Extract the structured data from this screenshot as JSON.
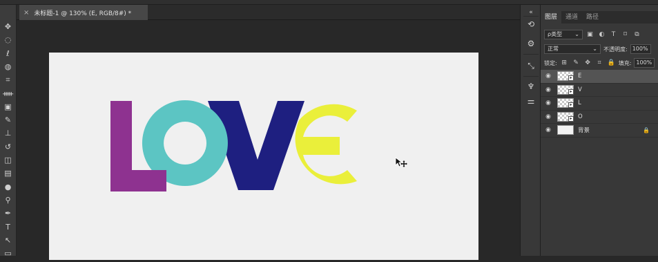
{
  "document": {
    "tab_title": "未标题-1 @ 130% (E, RGB/8#) *",
    "close_glyph": "×"
  },
  "artwork": {
    "letters": [
      "L",
      "O",
      "V",
      "E"
    ],
    "colors": {
      "L": "#8e3290",
      "O": "#5cc5c3",
      "V": "#1e1f80",
      "E": "#eaef3a"
    },
    "background": "#f0f0f0"
  },
  "toolbar": {
    "tools": [
      {
        "name": "move-tool",
        "glyph": "✥"
      },
      {
        "name": "marquee-tool",
        "glyph": "◌"
      },
      {
        "name": "lasso-tool",
        "glyph": "ℓ"
      },
      {
        "name": "quick-select-tool",
        "glyph": "◍"
      },
      {
        "name": "crop-tool",
        "glyph": "⌗"
      },
      {
        "name": "eyedropper-tool",
        "glyph": "ᚔ"
      },
      {
        "name": "frame-tool",
        "glyph": "▣"
      },
      {
        "name": "brush-tool",
        "glyph": "✎"
      },
      {
        "name": "stamp-tool",
        "glyph": "⊥"
      },
      {
        "name": "history-brush-tool",
        "glyph": "↺"
      },
      {
        "name": "eraser-tool",
        "glyph": "◫"
      },
      {
        "name": "gradient-tool",
        "glyph": "▤"
      },
      {
        "name": "blur-tool",
        "glyph": "●"
      },
      {
        "name": "dodge-tool",
        "glyph": "⚲"
      },
      {
        "name": "pen-tool",
        "glyph": "✒"
      },
      {
        "name": "type-tool",
        "glyph": "T"
      },
      {
        "name": "path-select-tool",
        "glyph": "↖"
      },
      {
        "name": "shape-tool",
        "glyph": "▭"
      }
    ]
  },
  "panel": {
    "tabs": [
      "图层",
      "通道",
      "路径"
    ],
    "filter_kind": "ρ类型",
    "blend_mode": "正常",
    "opacity_label": "不透明度:",
    "opacity_value": "100%",
    "lock_label": "锁定:",
    "fill_label": "填充:",
    "fill_value": "100%",
    "layers": [
      {
        "name": "E",
        "selected": true,
        "thumb": "checker",
        "smart": true,
        "locked": false
      },
      {
        "name": "V",
        "selected": false,
        "thumb": "checker",
        "smart": true,
        "locked": false
      },
      {
        "name": "L",
        "selected": false,
        "thumb": "checker",
        "smart": true,
        "locked": false
      },
      {
        "name": "O",
        "selected": false,
        "thumb": "checker",
        "smart": true,
        "locked": false
      },
      {
        "name": "背景",
        "selected": false,
        "thumb": "plain",
        "smart": false,
        "locked": true
      }
    ]
  }
}
